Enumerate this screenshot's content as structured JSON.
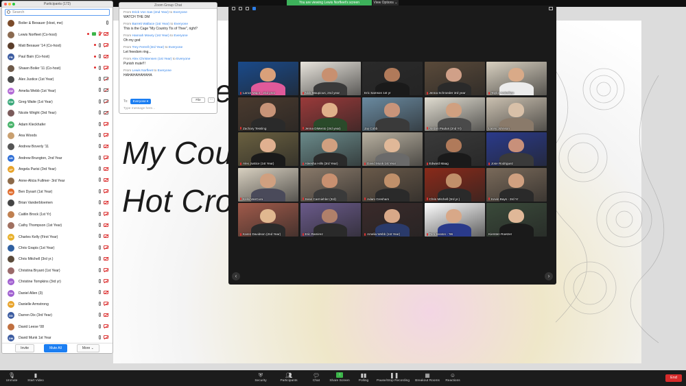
{
  "banner": {
    "viewing": "You are viewing Lewis Norfleet's screen",
    "view_options": "View Options ⌄"
  },
  "slide": {
    "line1": "My Cou",
    "line2": "Hot Cro",
    "fragment": "fe"
  },
  "participants": {
    "title": "Participants (172)",
    "search_placeholder": "Search",
    "items": [
      {
        "name": "Boiler & Bexauer (Host, me)",
        "initials": "",
        "color": "#7b4b2a",
        "icons": [
          "mic"
        ]
      },
      {
        "name": "Lewis Norfleet (Co-host)",
        "initials": "",
        "color": "#8a6a50",
        "icons": [
          "dot",
          "share",
          "mic-muted",
          "cam-off"
        ]
      },
      {
        "name": "Matt Bexauer '14 (Co-host)",
        "initials": "",
        "color": "#5a3d2a",
        "icons": [
          "dot",
          "mic",
          "cam-off"
        ]
      },
      {
        "name": "Paul Bain (Co-host)",
        "initials": "PB",
        "color": "#3b5ba0",
        "icons": [
          "dot",
          "mic",
          "cam-off"
        ]
      },
      {
        "name": "Shawn Boiler '11 (Co-host)",
        "initials": "",
        "color": "#6e5a4a",
        "icons": [
          "dot",
          "mic",
          "cam-off"
        ]
      },
      {
        "name": "Alex Justice (1st Year)",
        "initials": "",
        "color": "#4a4a4a",
        "icons": [
          "mic",
          "cam"
        ]
      },
      {
        "name": "Amelia Webb (1st Year)",
        "initials": "AW",
        "color": "#b36bd6",
        "icons": [
          "mic",
          "cam"
        ]
      },
      {
        "name": "Greg Waite (1st Year)",
        "initials": "GW",
        "color": "#3aa87a",
        "icons": [
          "mic",
          "cam"
        ]
      },
      {
        "name": "Nicole Wright (3rd Year)",
        "initials": "",
        "color": "#7a5a5a",
        "icons": [
          "mic",
          "cam"
        ]
      },
      {
        "name": "Adam Kleckhafer",
        "initials": "AK",
        "color": "#48b36a",
        "icons": [
          "mic",
          "cam-off"
        ]
      },
      {
        "name": "Ana Woods",
        "initials": "",
        "color": "#c9a070",
        "icons": [
          "mic",
          "cam-off"
        ]
      },
      {
        "name": "Andrew Boverly '11",
        "initials": "",
        "color": "#555",
        "icons": [
          "mic",
          "cam-off"
        ]
      },
      {
        "name": "Andrew Brungton, 2nd Year",
        "initials": "AB",
        "color": "#2f6fd6",
        "icons": [
          "mic",
          "cam-off"
        ]
      },
      {
        "name": "Angela Parisi (3rd Year)",
        "initials": "AP",
        "color": "#e8a32a",
        "icons": [
          "mic",
          "cam-off"
        ]
      },
      {
        "name": "Anne-Alicia Fullmer- 3rd Year",
        "initials": "",
        "color": "#8c6a4a",
        "icons": [
          "mic",
          "cam-off"
        ]
      },
      {
        "name": "Ben Dysart (1st Year)",
        "initials": "BD",
        "color": "#e06a2a",
        "icons": [
          "mic",
          "cam-off"
        ]
      },
      {
        "name": "Brian Vanderbloemen",
        "initials": "",
        "color": "#444",
        "icons": [
          "mic",
          "cam-off"
        ]
      },
      {
        "name": "Caitlin Brock (1st Yr)",
        "initials": "",
        "color": "#c08050",
        "icons": [
          "mic",
          "cam-off"
        ]
      },
      {
        "name": "Cathy Thompson (1st Year)",
        "initials": "",
        "color": "#a07060",
        "icons": [
          "mic",
          "cam-off"
        ]
      },
      {
        "name": "Charles Kelly (First Year)",
        "initials": "CK",
        "color": "#e8b02a",
        "icons": [
          "mic",
          "cam-off"
        ]
      },
      {
        "name": "Chris Grapis (1st Year)",
        "initials": "",
        "color": "#3060a0",
        "icons": [
          "mic",
          "cam-off"
        ]
      },
      {
        "name": "Chris Mitchell (3rd yr.)",
        "initials": "",
        "color": "#5a4a3a",
        "icons": [
          "mic",
          "cam-off"
        ]
      },
      {
        "name": "Christina Bryant (1st Year)",
        "initials": "",
        "color": "#9a6a6a",
        "icons": [
          "mic",
          "cam-off"
        ]
      },
      {
        "name": "Christine Tompkins (3rd yr)",
        "initials": "CT",
        "color": "#a05fd0",
        "icons": [
          "mic",
          "cam-off"
        ]
      },
      {
        "name": "Daniel Allen (3)",
        "initials": "DA",
        "color": "#a05fd0",
        "icons": [
          "mic",
          "cam-off"
        ]
      },
      {
        "name": "Danielle Armstrong",
        "initials": "DA",
        "color": "#e8a32a",
        "icons": [
          "mic",
          "cam-off"
        ]
      },
      {
        "name": "Darren Dix (3rd Year)",
        "initials": "DD",
        "color": "#3b5ba0",
        "icons": [
          "mic",
          "cam-off"
        ]
      },
      {
        "name": "David Leese '08",
        "initials": "",
        "color": "#c07040",
        "icons": [
          "mic",
          "cam-off"
        ]
      },
      {
        "name": "David Munk 1st Year",
        "initials": "DM",
        "color": "#3b5ba0",
        "icons": [
          "mic",
          "cam-off"
        ]
      }
    ],
    "invite": "Invite",
    "mute_all": "Mute All",
    "more": "More ⌄"
  },
  "chat": {
    "title": "Zoom Group Chat",
    "messages": [
      {
        "from_prefix": "From",
        "sender": "Erick Von Sas (2nd Year)",
        "to_word": "to",
        "to": "Everyone",
        "text": "WATCH THE DM"
      },
      {
        "from_prefix": "From",
        "sender": "Barrett Wallace (1st Year)",
        "to_word": "to",
        "to": "Everyone",
        "text": "This is the Cage \"My Country Tis of Thee\", right?"
      },
      {
        "from_prefix": "From",
        "sender": "Hannah Mowry (1st Year)",
        "to_word": "to",
        "to": "Everyone",
        "text": "Oh my god"
      },
      {
        "from_prefix": "From",
        "sender": "Trey Ferrell (3rd Year)",
        "to_word": "to",
        "to": "Everyone",
        "text": "Let freedom ring..."
      },
      {
        "from_prefix": "From",
        "sender": "Alex Christensen (1st Year)",
        "to_word": "to",
        "to": "Everyone",
        "text": "Punish mute!!!"
      },
      {
        "from_prefix": "From",
        "sender": "Lewis Norfleet",
        "to_word": "to",
        "to": "Everyone",
        "text": "HAHAHAHAHAHA"
      }
    ],
    "to_label": "To:",
    "to_value": "Everyone ▾",
    "file_label": "File",
    "more_label": "···",
    "input_placeholder": "Type message here..."
  },
  "gallery": {
    "tiles": [
      {
        "name": "Lance Major - 2nd year",
        "wall": "#1a4a8a",
        "skin": "#d9a07a",
        "shirt": "#e05a9a",
        "muted": true
      },
      {
        "name": "Nick Maupious, 2nd year",
        "wall": "#e8e4dc",
        "skin": "#c89070",
        "shirt": "#3a3a3a",
        "muted": true
      },
      {
        "name": "Eric Samson 1st yr",
        "wall": "#2a2a2a",
        "skin": "#b07a5a",
        "shirt": "#1a1a1a",
        "muted": false
      },
      {
        "name": "Jenna Schroeder 3rd year",
        "wall": "#5a4a3a",
        "skin": "#d0a088",
        "shirt": "#2a2a2a",
        "muted": true
      },
      {
        "name": "Taylor Arskellian",
        "wall": "#d8d0c0",
        "skin": "#d9aa88",
        "shirt": "#ececec",
        "muted": true
      },
      {
        "name": "Zachary Tessling",
        "wall": "#4a3a2e",
        "skin": "#c89478",
        "shirt": "#2a2a2a",
        "muted": true
      },
      {
        "name": "Jenna DiMento (3rd year)",
        "wall": "#9a3a3a",
        "skin": "#e0b08a",
        "shirt": "#2a4a2a",
        "muted": true
      },
      {
        "name": "Jay Cobb",
        "wall": "#6a8aa0",
        "skin": "#c8947a",
        "shirt": "#3a3a3a",
        "muted": false
      },
      {
        "name": "Jordan Paulus (2nd Yr)",
        "wall": "#e0dcd0",
        "skin": "#d0a080",
        "shirt": "#4a4a4a",
        "muted": true
      },
      {
        "name": "Lacey Johnson",
        "wall": "#cac0b0",
        "skin": "#d8c0a8",
        "shirt": "#8a7a6a",
        "muted": false
      },
      {
        "name": "Alex Justice (1st Year)",
        "wall": "#6a6040",
        "skin": "#e0b090",
        "shirt": "#1a1a1a",
        "muted": true
      },
      {
        "name": "Aleesha Hills (3rd Year)",
        "wall": "#6a8a8a",
        "skin": "#d0a080",
        "shirt": "#2a2a2a",
        "muted": true
      },
      {
        "name": "David Munk 1st Year",
        "wall": "#b8b0a0",
        "skin": "#e0b898",
        "shirt": "#6a6a6a",
        "muted": true
      },
      {
        "name": "Edward Maag",
        "wall": "#3a3a3a",
        "skin": "#b07a5a",
        "shirt": "#1a1a1a",
        "muted": true
      },
      {
        "name": "Jose Rodriguez",
        "wall": "#2a3a8a",
        "skin": "#c8907a",
        "shirt": "#3a3a3a",
        "muted": true
      },
      {
        "name": "Kelsi VanCura",
        "wall": "#d8d0c0",
        "skin": "#d0a080",
        "shirt": "#4a4a5a",
        "muted": true
      },
      {
        "name": "Sean Carmiehler (3rd)",
        "wall": "#8a7a6a",
        "skin": "#c89070",
        "shirt": "#3a3a3a",
        "muted": true
      },
      {
        "name": "Adam Gresham",
        "wall": "#6a5a4a",
        "skin": "#c0906a",
        "shirt": "#2a2a2a",
        "muted": true
      },
      {
        "name": "Chris Mitchell (3rd yr.)",
        "wall": "#8a2a1a",
        "skin": "#c0906a",
        "shirt": "#2a2a2a",
        "muted": true
      },
      {
        "name": "Kevin Bays - 3rd Yr",
        "wall": "#7a6a5a",
        "skin": "#d0a080",
        "shirt": "#2a2a2a",
        "muted": true
      },
      {
        "name": "Karen Davidson (2nd Year)",
        "wall": "#a05a4a",
        "skin": "#e0b890",
        "shirt": "#2a2a2a",
        "muted": true
      },
      {
        "name": "Eric Ramirez",
        "wall": "#6a5a8a",
        "skin": "#b0806a",
        "shirt": "#2a2a2a",
        "muted": true
      },
      {
        "name": "Amelia Webb (1st Year)",
        "wall": "#3a2a2a",
        "skin": "#d8a888",
        "shirt": "#2a3a6a",
        "muted": true
      },
      {
        "name": "Tom Seaton - '96",
        "wall": "#ffffff",
        "skin": "#d8a888",
        "shirt": "#2a3a8a",
        "muted": true
      },
      {
        "name": "Kiersten Roetzer",
        "wall": "#3a4a3a",
        "skin": "#e0b898",
        "shirt": "#1a1a1a",
        "muted": false
      }
    ]
  },
  "toolbar": {
    "unmute": "Unmute",
    "start_video": "Start Video",
    "security": "Security",
    "participants": "Participants",
    "participant_count": "172",
    "chat": "Chat",
    "share_screen": "Share Screen",
    "polling": "Polling",
    "pause_recording": "Pause/Stop Recording",
    "breakout": "Breakout Rooms",
    "reactions": "Reactions",
    "end": "End"
  }
}
